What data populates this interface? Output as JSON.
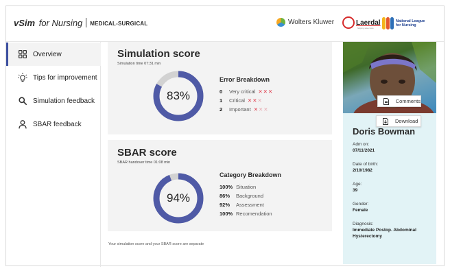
{
  "header": {
    "brand_v": "v",
    "brand_sim": "Sim",
    "brand_for": "for Nursing",
    "brand_product": "MEDICAL-SURGICAL",
    "logo_wolters": "Wolters Kluwer",
    "logo_laerdal": "Laerdal",
    "logo_laerdal_tagline": "helping save lives",
    "logo_nln_line1": "National League",
    "logo_nln_line2": "for Nursing"
  },
  "sidebar": {
    "items": [
      {
        "label": "Overview",
        "icon": "grid-icon",
        "active": true
      },
      {
        "label": "Tips for improvement",
        "icon": "lightbulb-icon",
        "active": false
      },
      {
        "label": "Simulation feedback",
        "icon": "search-icon",
        "active": false
      },
      {
        "label": "SBAR feedback",
        "icon": "person-icon",
        "active": false
      }
    ]
  },
  "simulation": {
    "title": "Simulation score",
    "time_label": "Simulation time 07:31 min",
    "score_label": "83%",
    "score_fraction": 0.83,
    "breakdown_title": "Error Breakdown",
    "rows": [
      {
        "count": "0",
        "label": "Very critical",
        "marks_on": 3,
        "marks_total": 3
      },
      {
        "count": "1",
        "label": "Critical",
        "marks_on": 2,
        "marks_total": 3
      },
      {
        "count": "2",
        "label": "Important",
        "marks_on": 1,
        "marks_total": 3
      }
    ]
  },
  "sbar": {
    "title": "SBAR score",
    "time_label": "SBAR handover time 01:08 min",
    "score_label": "94%",
    "score_fraction": 0.94,
    "breakdown_title": "Category Breakdown",
    "rows": [
      {
        "value": "100%",
        "label": "Situation"
      },
      {
        "value": "86%",
        "label": "Background"
      },
      {
        "value": "92%",
        "label": "Assessment"
      },
      {
        "value": "100%",
        "label": "Recomendation"
      }
    ]
  },
  "footnote": "Your simulation score and your SBAR score are separate",
  "patient": {
    "name": "Doris Bowman",
    "comments_label": "Comments",
    "download_label": "Download",
    "fields": [
      {
        "label": "Adm on:",
        "value": "07/11/2021"
      },
      {
        "label": "Date of birth:",
        "value": "2/10/1982"
      },
      {
        "label": "Age:",
        "value": "39"
      },
      {
        "label": "Gender:",
        "value": "Female"
      },
      {
        "label": "Diagnosis:",
        "value": "Immediate Postop. Abdominal Hysterectomy"
      }
    ]
  },
  "colors": {
    "accent": "#4f5aa6",
    "ring_track": "#d2d2d2",
    "card_bg": "#f3f3f3",
    "patient_bg": "#e2f3f6",
    "error_mark": "#e03a4a"
  }
}
